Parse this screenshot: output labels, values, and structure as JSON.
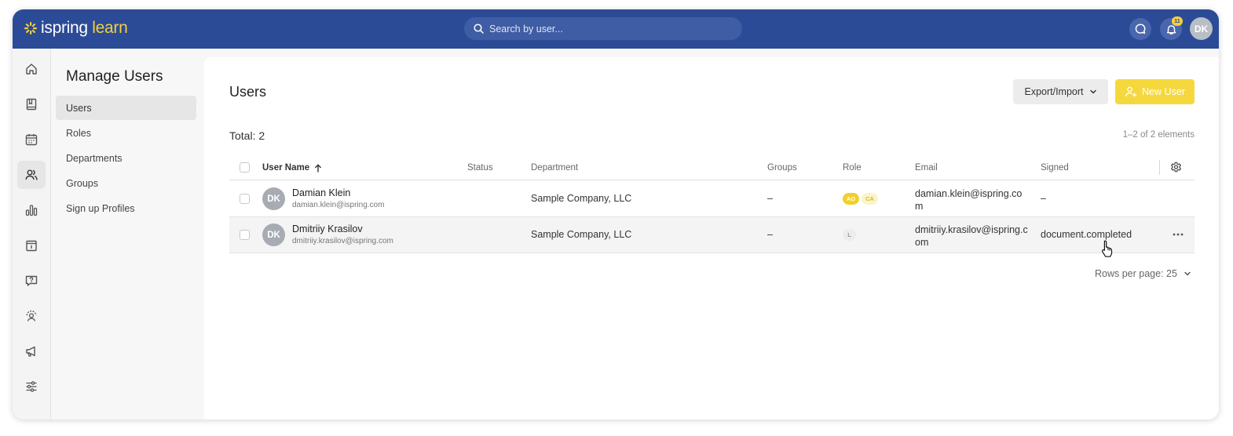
{
  "header": {
    "logo_prefix": "ispring",
    "logo_suffix": " learn",
    "search_placeholder": "Search by user...",
    "notification_count": "11",
    "user_initials": "DK",
    "colors": {
      "topbar": "#2c4b97",
      "accent": "#f5cf3b"
    }
  },
  "rail": {
    "icons": [
      "home-icon",
      "book-icon",
      "calendar-icon",
      "users-icon",
      "chart-icon",
      "info-card-icon",
      "question-chat-icon",
      "support-icon",
      "megaphone-icon",
      "sliders-icon"
    ],
    "active": "users-icon"
  },
  "sidepanel": {
    "title": "Manage Users",
    "items": [
      {
        "label": "Users",
        "active": true
      },
      {
        "label": "Roles"
      },
      {
        "label": "Departments"
      },
      {
        "label": "Groups"
      },
      {
        "label": "Sign up Profiles"
      }
    ]
  },
  "main": {
    "title": "Users",
    "export_label": "Export/Import",
    "new_user_label": "New User",
    "total": "Total: 2",
    "count": "1–2 of 2 elements",
    "columns": [
      "User Name",
      "Status",
      "Department",
      "Groups",
      "Role",
      "Email",
      "Signed"
    ],
    "rows": [
      {
        "initials": "DK",
        "name": "Damian Klein",
        "email_small": "damian.klein@ispring.com",
        "status": "",
        "department": "Sample Company, LLC",
        "groups": "–",
        "roles": [
          "AO",
          "CA"
        ],
        "email": "damian.klein@ispring.com",
        "signed": "–"
      },
      {
        "initials": "DK",
        "name": "Dmitriiy Krasilov",
        "email_small": "dmitriiy.krasilov@ispring.com",
        "status": "",
        "department": "Sample Company, LLC",
        "groups": "–",
        "roles": [
          "L"
        ],
        "email": "dmitriiy.krasilov@ispring.com",
        "signed": "document.completed"
      }
    ],
    "rows_per_page": "Rows per page: 25"
  }
}
